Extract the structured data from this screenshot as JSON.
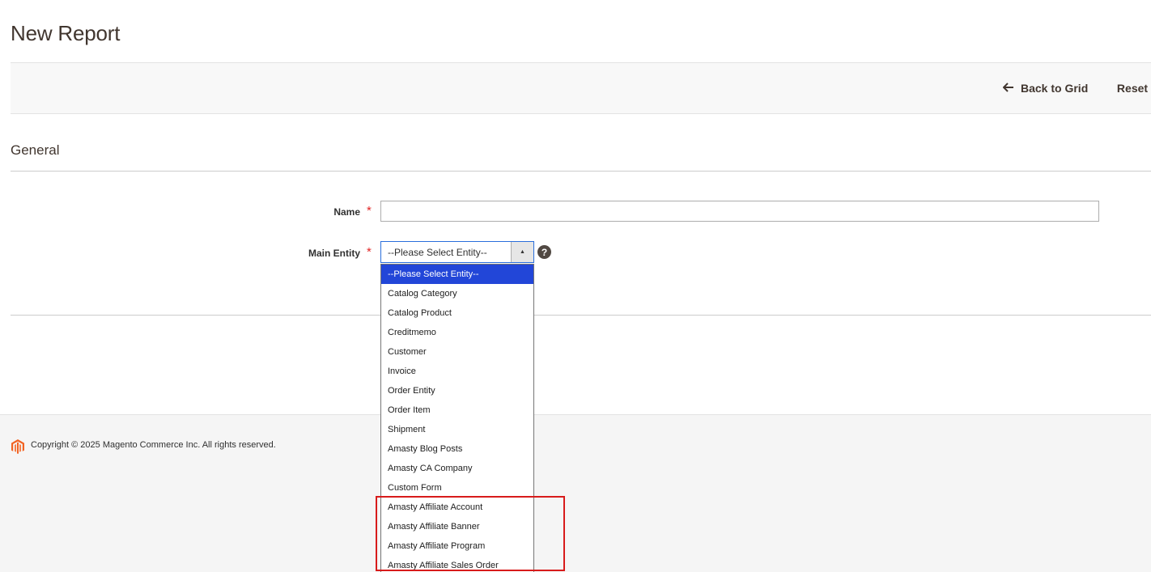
{
  "page": {
    "title": "New Report"
  },
  "actions": {
    "back_label": "Back to Grid",
    "reset_label": "Reset"
  },
  "section": {
    "title": "General"
  },
  "form": {
    "name": {
      "label": "Name",
      "required_mark": "*",
      "value": ""
    },
    "main_entity": {
      "label": "Main Entity",
      "required_mark": "*",
      "selected": "--Please Select Entity--",
      "help": "?"
    }
  },
  "dropdown": {
    "options": [
      "--Please Select Entity--",
      "Catalog Category",
      "Catalog Product",
      "Creditmemo",
      "Customer",
      "Invoice",
      "Order Entity",
      "Order Item",
      "Shipment",
      "Amasty Blog Posts",
      "Amasty CA Company",
      "Custom Form",
      "Amasty Affiliate Account",
      "Amasty Affiliate Banner",
      "Amasty Affiliate Program",
      "Amasty Affiliate Sales Order"
    ]
  },
  "footer": {
    "copyright": "Copyright © 2025 Magento Commerce Inc. All rights reserved."
  },
  "colors": {
    "selected_option": "#2246d8",
    "highlight": "#d81b1b",
    "required": "#e22626",
    "logo": "#f26322"
  }
}
